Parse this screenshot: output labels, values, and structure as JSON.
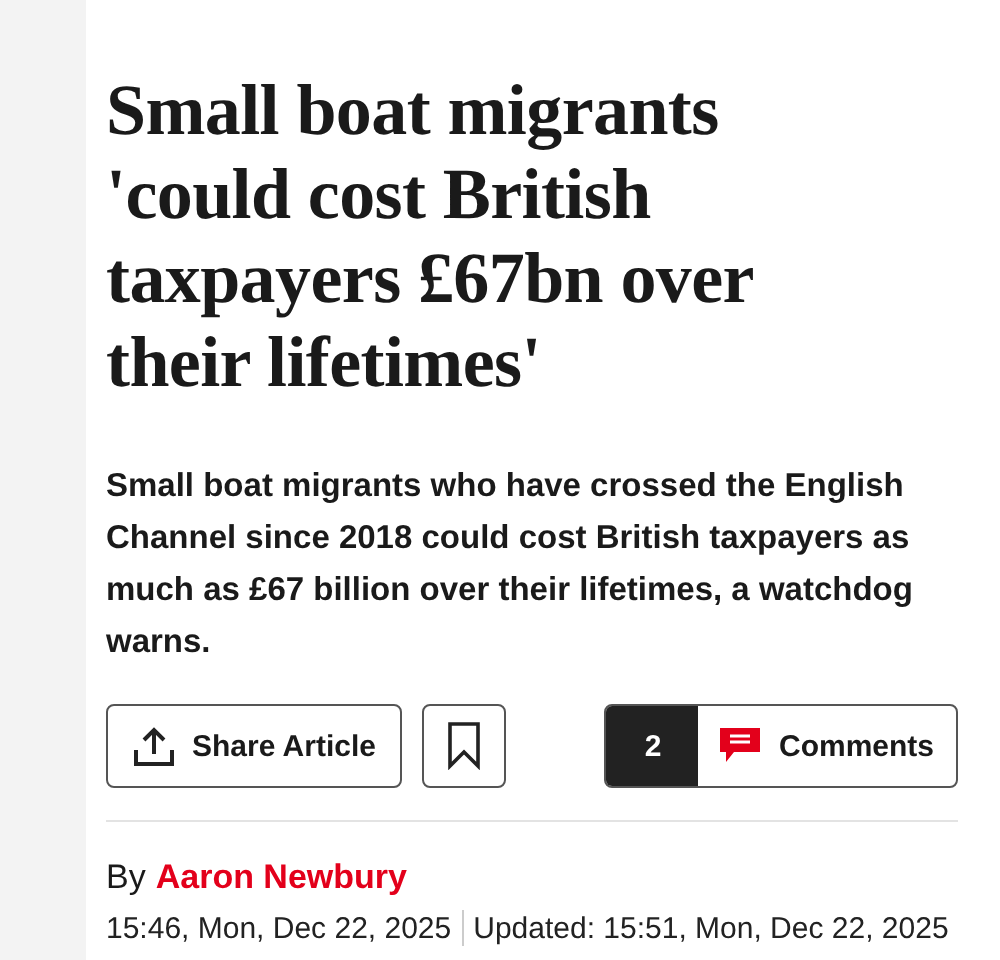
{
  "headline": "Small boat migrants 'could cost British taxpayers £67bn over their lifetimes'",
  "standfirst": "Small boat migrants who have crossed the English Channel since 2018 could cost British taxpayers as much as £67 billion over their lifetimes, a watchdog warns.",
  "actions": {
    "share": "Share Article",
    "comment_count": "2",
    "comments": "Comments"
  },
  "byline": {
    "prefix": "By",
    "author": "Aaron Newbury"
  },
  "dates": {
    "published": "15:46, Mon, Dec 22, 2025",
    "updated": "Updated: 15:51, Mon, Dec 22, 2025"
  }
}
